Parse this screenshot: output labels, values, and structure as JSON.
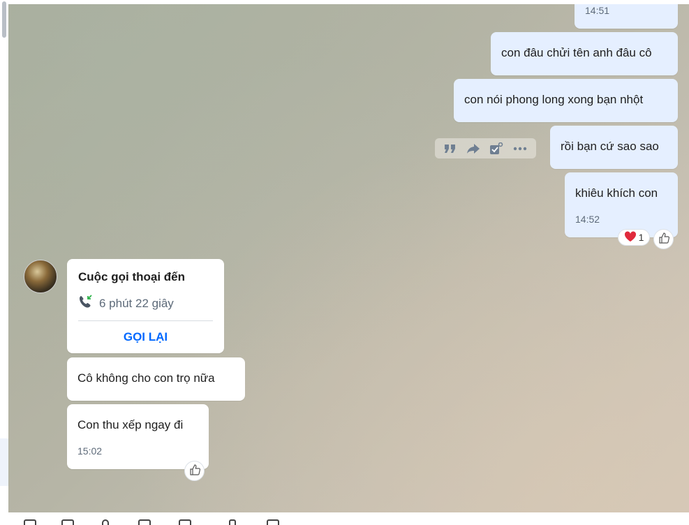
{
  "messages_out": [
    {
      "time": "14:51"
    },
    {
      "text": "con đâu chửi tên anh đâu cô"
    },
    {
      "text": "con nói phong long xong bạn nhột"
    },
    {
      "text": "rồi bạn cứ sao sao"
    },
    {
      "text": "khiêu khích con",
      "time": "14:52",
      "heart_count": "1"
    }
  ],
  "call_card": {
    "title": "Cuộc gọi thoại đến",
    "duration": "6 phút 22 giây",
    "callback_label": "GỌI LẠI"
  },
  "messages_in": [
    {
      "text": "Cô không cho con trọ nữa"
    },
    {
      "text": "Con thu xếp ngay đi",
      "time": "15:02"
    }
  ],
  "message_toolbar": {
    "icons": [
      "quote-icon",
      "forward-icon",
      "add-task-icon",
      "more-options-icon"
    ]
  },
  "colors": {
    "outgoing_bubble": "#e5efff",
    "incoming_bubble": "#ffffff",
    "accent": "#0068ff",
    "timestamp": "#5d6a79",
    "heart": "#e02a3c",
    "call_icon": "#4a5563"
  }
}
